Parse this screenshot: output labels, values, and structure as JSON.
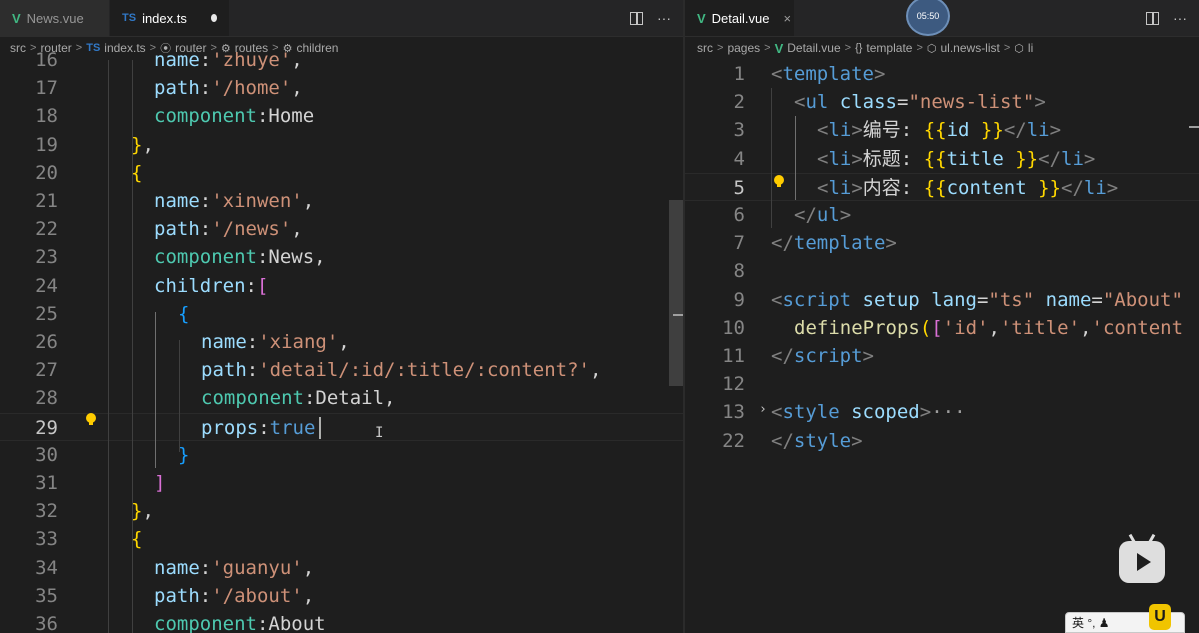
{
  "left_pane": {
    "tabs": [
      {
        "icon": "V",
        "label": "News.vue"
      },
      {
        "icon": "TS",
        "label": "index.ts"
      }
    ],
    "actions": {
      "more": "···"
    },
    "breadcrumb": {
      "items": [
        "src",
        "router",
        "index.ts",
        "router",
        "routes",
        "children"
      ],
      "ts_icon": "TS",
      "sep": ">"
    },
    "lines": [
      {
        "n": "16",
        "t": [
          [
            "key",
            "name"
          ],
          [
            "pl",
            ":"
          ],
          [
            "str",
            "'zhuye'"
          ],
          [
            "pl",
            ","
          ]
        ]
      },
      {
        "n": "17",
        "t": [
          [
            "key",
            "path"
          ],
          [
            "pl",
            ":"
          ],
          [
            "str",
            "'/home'"
          ],
          [
            "pl",
            ","
          ]
        ]
      },
      {
        "n": "18",
        "t": [
          [
            "prop",
            "component"
          ],
          [
            "pl",
            ":Home"
          ]
        ]
      },
      {
        "n": "19",
        "t": [
          [
            "br1",
            "}"
          ],
          [
            "pl",
            ","
          ]
        ]
      },
      {
        "n": "20",
        "t": [
          [
            "br1",
            "{"
          ]
        ]
      },
      {
        "n": "21",
        "t": [
          [
            "key",
            "name"
          ],
          [
            "pl",
            ":"
          ],
          [
            "str",
            "'xinwen'"
          ],
          [
            "pl",
            ","
          ]
        ]
      },
      {
        "n": "22",
        "t": [
          [
            "key",
            "path"
          ],
          [
            "pl",
            ":"
          ],
          [
            "str",
            "'/news'"
          ],
          [
            "pl",
            ","
          ]
        ]
      },
      {
        "n": "23",
        "t": [
          [
            "prop",
            "component"
          ],
          [
            "pl",
            ":News,"
          ]
        ]
      },
      {
        "n": "24",
        "t": [
          [
            "key",
            "children"
          ],
          [
            "pl",
            ":"
          ],
          [
            "br2",
            "["
          ]
        ]
      },
      {
        "n": "25",
        "t": [
          [
            "br3",
            "{"
          ]
        ]
      },
      {
        "n": "26",
        "t": [
          [
            "key",
            "name"
          ],
          [
            "pl",
            ":"
          ],
          [
            "str",
            "'xiang'"
          ],
          [
            "pl",
            ","
          ]
        ]
      },
      {
        "n": "27",
        "t": [
          [
            "key",
            "path"
          ],
          [
            "pl",
            ":"
          ],
          [
            "str",
            "'detail/:id/:title/:content?'"
          ],
          [
            "pl",
            ","
          ]
        ]
      },
      {
        "n": "28",
        "t": [
          [
            "prop",
            "component"
          ],
          [
            "pl",
            ":Detail,"
          ]
        ]
      },
      {
        "n": "29",
        "t": [
          [
            "key",
            "props"
          ],
          [
            "pl",
            ":"
          ],
          [
            "kw",
            "true"
          ]
        ]
      },
      {
        "n": "30",
        "t": [
          [
            "br3",
            "}"
          ]
        ]
      },
      {
        "n": "31",
        "t": [
          [
            "br2",
            "]"
          ]
        ]
      },
      {
        "n": "32",
        "t": [
          [
            "br1",
            "}"
          ],
          [
            "pl",
            ","
          ]
        ]
      },
      {
        "n": "33",
        "t": [
          [
            "br1",
            "{"
          ]
        ]
      },
      {
        "n": "34",
        "t": [
          [
            "key",
            "name"
          ],
          [
            "pl",
            ":"
          ],
          [
            "str",
            "'guanyu'"
          ],
          [
            "pl",
            ","
          ]
        ]
      },
      {
        "n": "35",
        "t": [
          [
            "key",
            "path"
          ],
          [
            "pl",
            ":"
          ],
          [
            "str",
            "'/about'"
          ],
          [
            "pl",
            ","
          ]
        ]
      },
      {
        "n": "36",
        "t": [
          [
            "prop",
            "component"
          ],
          [
            "pl",
            ":About"
          ]
        ]
      }
    ]
  },
  "right_pane": {
    "tab": {
      "icon": "V",
      "label": "Detail.vue",
      "close": "×"
    },
    "actions": {
      "more": "···"
    },
    "breadcrumb": {
      "items": [
        "src",
        "pages",
        "Detail.vue",
        "template",
        "ul.news-list",
        "li"
      ],
      "sep": ">"
    },
    "lines": [
      {
        "n": "1",
        "t": [
          [
            "tagp",
            "<"
          ],
          [
            "tagn",
            "template"
          ],
          [
            "tagp",
            ">"
          ]
        ]
      },
      {
        "n": "2",
        "t": [
          [
            "tagp",
            "<"
          ],
          [
            "tagn",
            "ul"
          ],
          [
            "pl",
            " "
          ],
          [
            "attr",
            "class"
          ],
          [
            "pl",
            "="
          ],
          [
            "str",
            "\""
          ],
          [
            "str",
            "news-list"
          ],
          [
            "str",
            "\""
          ],
          [
            "tagp",
            ">"
          ]
        ]
      },
      {
        "n": "3",
        "t": [
          [
            "tagp",
            "<"
          ],
          [
            "tagn",
            "li"
          ],
          [
            "tagp",
            ">"
          ],
          [
            "cn",
            "编号: "
          ],
          [
            "br1",
            "{{"
          ],
          [
            "key",
            "id"
          ],
          [
            "pl",
            " "
          ],
          [
            "br1",
            "}}"
          ],
          [
            "tagp",
            "</"
          ],
          [
            "tagn",
            "li"
          ],
          [
            "tagp",
            ">"
          ]
        ]
      },
      {
        "n": "4",
        "t": [
          [
            "tagp",
            "<"
          ],
          [
            "tagn",
            "li"
          ],
          [
            "tagp",
            ">"
          ],
          [
            "cn",
            "标题: "
          ],
          [
            "br1",
            "{{"
          ],
          [
            "key",
            "title"
          ],
          [
            "pl",
            " "
          ],
          [
            "br1",
            "}}"
          ],
          [
            "tagp",
            "</"
          ],
          [
            "tagn",
            "li"
          ],
          [
            "tagp",
            ">"
          ]
        ]
      },
      {
        "n": "5",
        "t": [
          [
            "tagp",
            "<"
          ],
          [
            "tagn",
            "li"
          ],
          [
            "tagp",
            ">"
          ],
          [
            "cn",
            "内容: "
          ],
          [
            "br1",
            "{{"
          ],
          [
            "key",
            "content"
          ],
          [
            "pl",
            " "
          ],
          [
            "br1",
            "}}"
          ],
          [
            "tagp",
            "</"
          ],
          [
            "tagn",
            "li"
          ],
          [
            "tagp",
            ">"
          ]
        ]
      },
      {
        "n": "6",
        "t": [
          [
            "tagp",
            "</"
          ],
          [
            "tagn",
            "ul"
          ],
          [
            "tagp",
            ">"
          ]
        ]
      },
      {
        "n": "7",
        "t": [
          [
            "tagp",
            "</"
          ],
          [
            "tagn",
            "template"
          ],
          [
            "tagp",
            ">"
          ]
        ]
      },
      {
        "n": "8",
        "t": []
      },
      {
        "n": "9",
        "t": [
          [
            "tagp",
            "<"
          ],
          [
            "tagn",
            "script"
          ],
          [
            "pl",
            " "
          ],
          [
            "attr",
            "setup"
          ],
          [
            "pl",
            " "
          ],
          [
            "attr",
            "lang"
          ],
          [
            "pl",
            "="
          ],
          [
            "str",
            "\"ts\""
          ],
          [
            "pl",
            " "
          ],
          [
            "attr",
            "name"
          ],
          [
            "pl",
            "="
          ],
          [
            "str",
            "\"About\""
          ]
        ]
      },
      {
        "n": "10",
        "t": [
          [
            "fn",
            "defineProps"
          ],
          [
            "br1",
            "("
          ],
          [
            "br2",
            "["
          ],
          [
            "str",
            "'id'"
          ],
          [
            "pl",
            ","
          ],
          [
            "str",
            "'title'"
          ],
          [
            "pl",
            ","
          ],
          [
            "str",
            "'content"
          ]
        ]
      },
      {
        "n": "11",
        "t": [
          [
            "tagp",
            "</"
          ],
          [
            "tagn",
            "script"
          ],
          [
            "tagp",
            ">"
          ]
        ]
      },
      {
        "n": "12",
        "t": []
      },
      {
        "n": "13",
        "t": [
          [
            "tagp",
            "<"
          ],
          [
            "tagn",
            "style"
          ],
          [
            "pl",
            " "
          ],
          [
            "attr",
            "scoped"
          ],
          [
            "tagp",
            ">"
          ],
          [
            "ellip",
            "···"
          ]
        ]
      },
      {
        "n": "22",
        "t": [
          [
            "tagp",
            "</"
          ],
          [
            "tagn",
            "style"
          ],
          [
            "tagp",
            ">"
          ]
        ]
      }
    ]
  },
  "overlay": {
    "clock": "05:50",
    "ime_label": "英 °, ♟",
    "ime_badge": "U"
  }
}
